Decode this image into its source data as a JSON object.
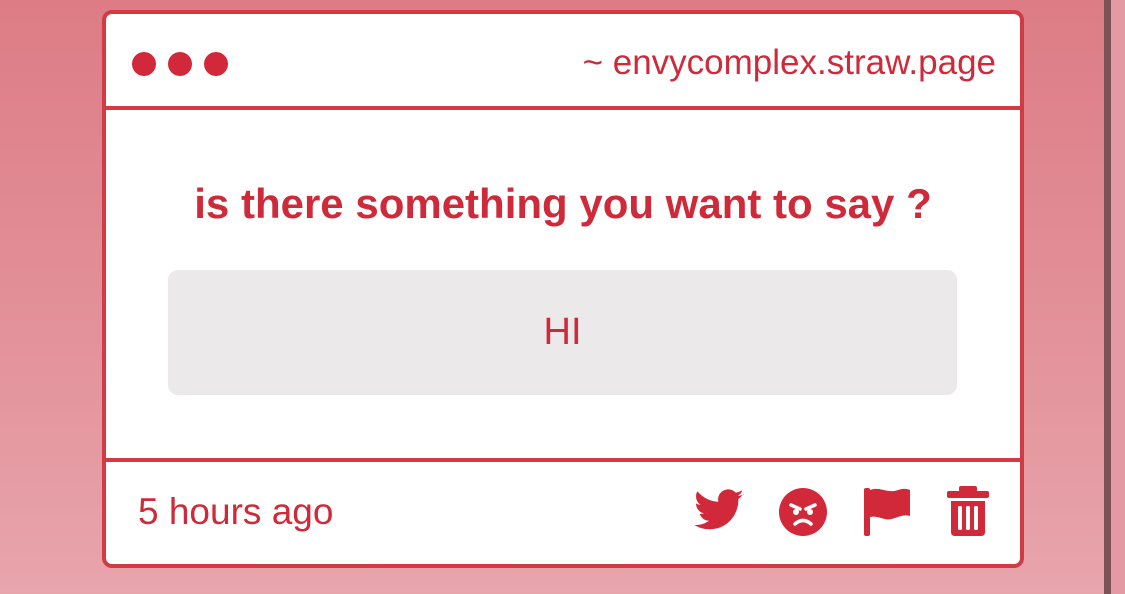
{
  "window": {
    "url": "~ envycomplex.straw.page"
  },
  "message": {
    "question": "is there something you want to say ?",
    "answer": "HI"
  },
  "footer": {
    "timestamp": "5 hours ago",
    "actions": [
      {
        "icon": "twitter-icon"
      },
      {
        "icon": "angry-face-icon"
      },
      {
        "icon": "flag-icon"
      },
      {
        "icon": "trash-icon"
      }
    ]
  },
  "colors": {
    "accent": "#d1283a",
    "card_border": "#d23a44",
    "answer_background": "#ebe9ea",
    "page_background": "#e08a93"
  }
}
